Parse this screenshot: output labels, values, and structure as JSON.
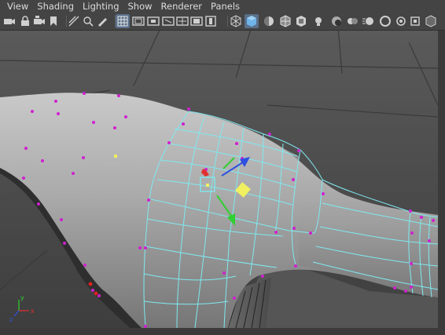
{
  "menu": [
    "View",
    "Shading",
    "Lighting",
    "Show",
    "Renderer",
    "Panels"
  ],
  "toolbar": {
    "icons": [
      "camera-select-icon",
      "camera-lock-icon",
      "camera-attributes-icon",
      "bookmark-icon",
      "image-plane-icon",
      "2d-pan-zoom-icon",
      "grease-pencil-icon",
      "grid-icon",
      "film-gate-icon",
      "resolution-gate-icon",
      "gate-mask-icon",
      "field-chart-icon",
      "safe-action-icon",
      "safe-title-icon",
      "wireframe-icon",
      "smooth-shade-icon",
      "use-default-material-icon",
      "wireframe-on-shaded-icon",
      "textured-icon",
      "all-lights-icon",
      "shadows-icon",
      "screen-space-ao-icon",
      "motion-blur-icon",
      "multisample-aa-icon",
      "depth-of-field-icon",
      "isolate-select-icon",
      "xray-icon",
      "xray-joints-icon"
    ],
    "active": [
      "grid-icon",
      "smooth-shade-icon"
    ]
  },
  "colors": {
    "menubar_bg": "#444444",
    "viewport_bg": "#4e4e4e",
    "wire_cyan": "#7fe9f0",
    "vertex_magenta": "#d020d0",
    "axis_x": "#e03030",
    "axis_y": "#30d030",
    "axis_z": "#3050e0",
    "pivot": "#f0f060"
  },
  "axis_labels": {
    "x": "x",
    "y": "y",
    "z": "z"
  }
}
